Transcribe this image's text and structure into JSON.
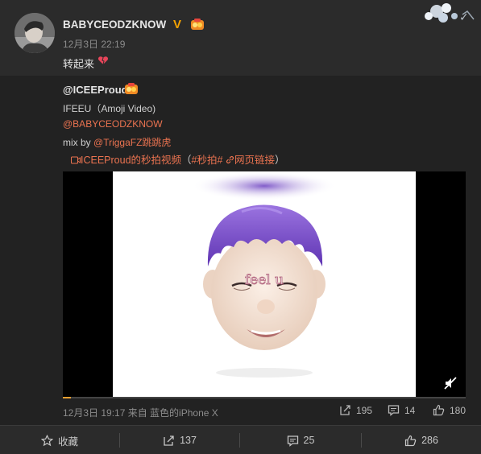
{
  "post": {
    "username": "BABYCEODZKNOW",
    "verified_mark": "V",
    "timestamp": "12月3日 22:19",
    "text": "转起来",
    "icons": [
      "avatar",
      "verified-icon",
      "vip-badge-icon",
      "broken-heart-icon"
    ]
  },
  "repost": {
    "author": "@ICEEProud",
    "line1": "IFEEU（Amoji Video)",
    "mention": "@BABYCEODZKNOW",
    "mix_prefix": "mix by ",
    "mix_mention": "@TriggaFZ跳跳虎",
    "video_link": "ICEEProud的秒拍视频",
    "tag_open": "（",
    "tag": "#秒拍#",
    "web_link": "网页链接",
    "tag_close": "）",
    "video": {
      "overlay_text": "feel u",
      "progress": 0.02,
      "muted": true
    },
    "meta": "12月3日 19:17 来自 蓝色的iPhone X",
    "stats": {
      "reposts": "195",
      "comments": "14",
      "likes": "180"
    }
  },
  "footer": {
    "favorite": "收藏",
    "reposts": "137",
    "comments": "25",
    "likes": "286"
  },
  "colors": {
    "link": "#eb7350",
    "verified": "#f5a300",
    "panel": "#222222",
    "background": "#2b2b2b",
    "hair": "#7a4ec7"
  }
}
